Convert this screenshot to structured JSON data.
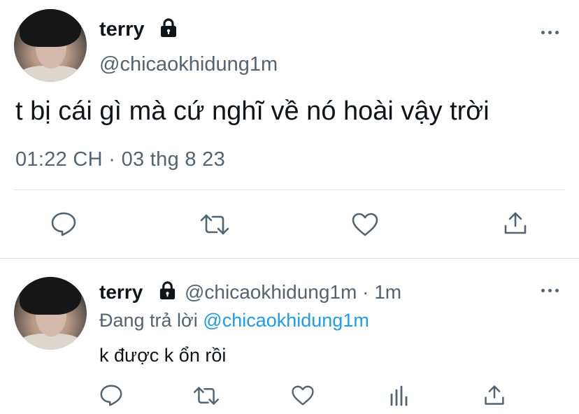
{
  "main_tweet": {
    "display_name": "terry",
    "handle": "@chicaokhidung1m",
    "text": "t bị cái gì mà cứ nghĩ về nó hoài vậy trời",
    "timestamp": "01:22 CH · 03 thg 8 23",
    "icons": [
      "lock-icon",
      "more-icon",
      "reply-icon",
      "retweet-icon",
      "like-icon",
      "share-icon"
    ]
  },
  "reply_tweet": {
    "display_name": "terry",
    "handle_time": "@chicaokhidung1m · 1m",
    "replying_prefix": "Đang trả lời",
    "replying_to": "@chicaokhidung1m",
    "text": "k được k ổn rồi",
    "icons": [
      "lock-icon",
      "more-icon",
      "reply-icon",
      "retweet-icon",
      "like-icon",
      "analytics-icon",
      "share-icon"
    ]
  },
  "colors": {
    "text_primary": "#0f1419",
    "text_secondary": "#536471",
    "mention": "#1d9bf0",
    "divider": "#e1e4e6"
  }
}
